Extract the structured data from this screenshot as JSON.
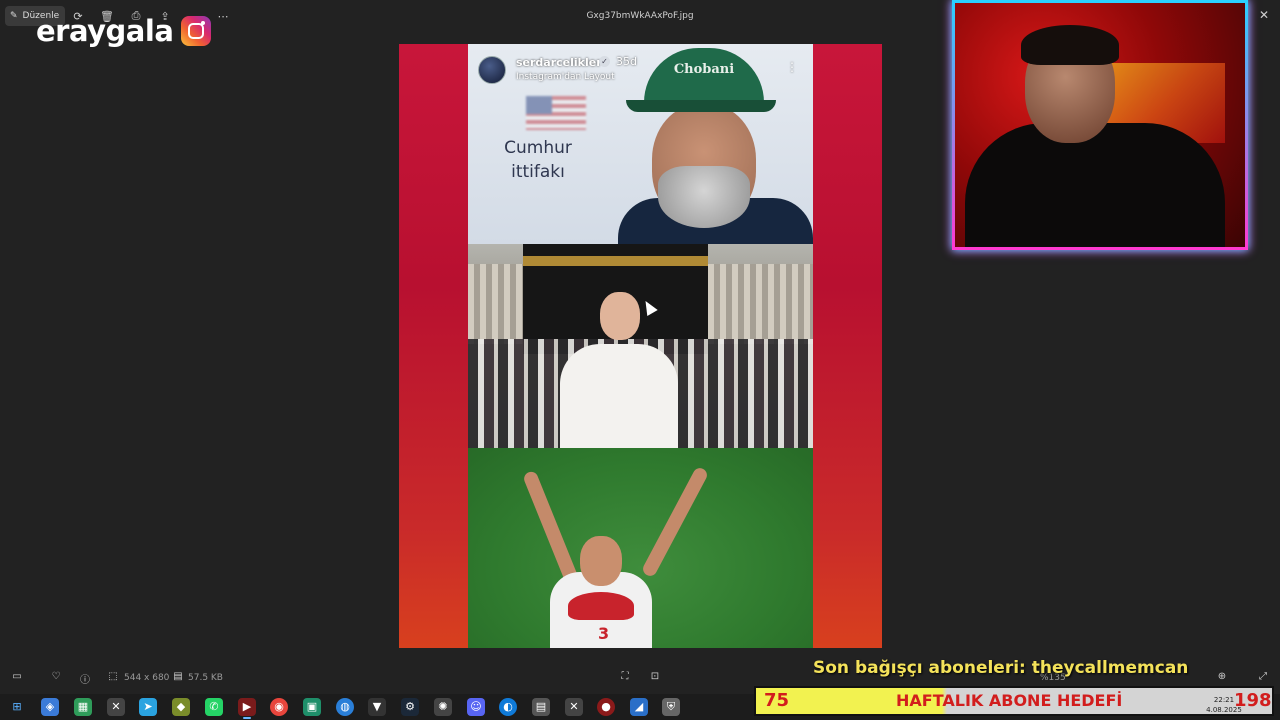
{
  "toolbar": {
    "edit_label": "Düzenle",
    "filename": "Gxg37bmWkAAxPoF.jpg",
    "icons": [
      "pen-icon",
      "rotate-icon",
      "delete-icon",
      "print-icon",
      "share-icon",
      "more-icon"
    ]
  },
  "brand": {
    "name": "eraygala",
    "icon": "instagram-icon"
  },
  "post": {
    "username": "serdarcelikler",
    "age": "35d",
    "subtitle": "Instagram'dan Layout",
    "overlay_line1": "Cumhur",
    "overlay_line2": "ittifakı",
    "cap_text": "Chobani",
    "jersey_number": "3"
  },
  "status": {
    "dimensions": "544 x 680",
    "file_size": "57.5 KB",
    "zoom": "%135"
  },
  "stream": {
    "donor_text": "Son bağışçı aboneleri: theycallmemcan",
    "goal_current": "75",
    "goal_label": "HAFTALIK ABONE HEDEFİ",
    "goal_target": "198"
  },
  "clock": {
    "time": "22:21",
    "date": "4.08.2025"
  }
}
